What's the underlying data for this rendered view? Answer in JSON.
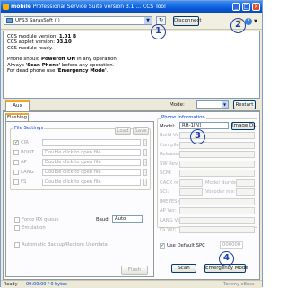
{
  "title": {
    "brand": "mobile",
    "app": "Professional Service Suite version 3.1 ... CCS Tool"
  },
  "toolbar": {
    "device": "UFS3 SarasSoft ( )",
    "disconnect_label": "Disconnect",
    "dropdown_glyph": "▼"
  },
  "log": [
    "CCS module version: 1.01 B",
    "CCS applet version: 03.10",
    "CCS module ready.",
    "",
    "Phone should Poweroff ON in any operation.",
    "Always 'Scan Phone' before any operation.",
    "For dead phone use 'Emergency Mode'."
  ],
  "tabs": {
    "main": "Aux",
    "sub": "Flashing"
  },
  "mode": {
    "label": "Mode:",
    "value": "",
    "restart_label": "Restart"
  },
  "file_settings": {
    "title": "File Settings",
    "load_label": "Load",
    "save_label": "Save",
    "rows": [
      {
        "label": "CIR",
        "value": "",
        "checked": true
      },
      {
        "label": "BOOT",
        "value": "Double click to open file",
        "checked": false
      },
      {
        "label": "AP",
        "value": "Double click to open file",
        "checked": false
      },
      {
        "label": "LANG",
        "value": "Double click to open file",
        "checked": false
      },
      {
        "label": "FS",
        "value": "Double click to open file",
        "checked": false
      }
    ]
  },
  "options": {
    "force_rx": "Force RX queue",
    "emulation": "Emulation",
    "auto_backup": "Automatic Backup/Restore Userdata",
    "baud_label": "Baud:",
    "baud_value": "Auto",
    "flash_label": "Flash"
  },
  "phone_info": {
    "title": "Phone Information",
    "model_label": "Model:",
    "model_value": "RH-1[N]",
    "image_dl": "Image DL",
    "fields": [
      "Build Ver:",
      "Compiled:",
      "Released:",
      "SW Rev:",
      "SCM:",
      "CACK rev:",
      "SCI:",
      "IMEI/ESN:",
      "AP Ver:",
      "LANG Ver:",
      "FS Ver:"
    ],
    "model_number": "Model Number:",
    "vocoder": "Vocoder rev:",
    "use_default_spc": "Use Default SPC",
    "spc_value": "000000",
    "scan_label": "Scan",
    "emergency_label": "Emergency Mode"
  },
  "annotations": [
    "1",
    "2",
    "3",
    "4"
  ],
  "status": {
    "left": "Ready",
    "mid": "00:00:00 / 0 bytes",
    "right": "Tommy eBuss"
  }
}
